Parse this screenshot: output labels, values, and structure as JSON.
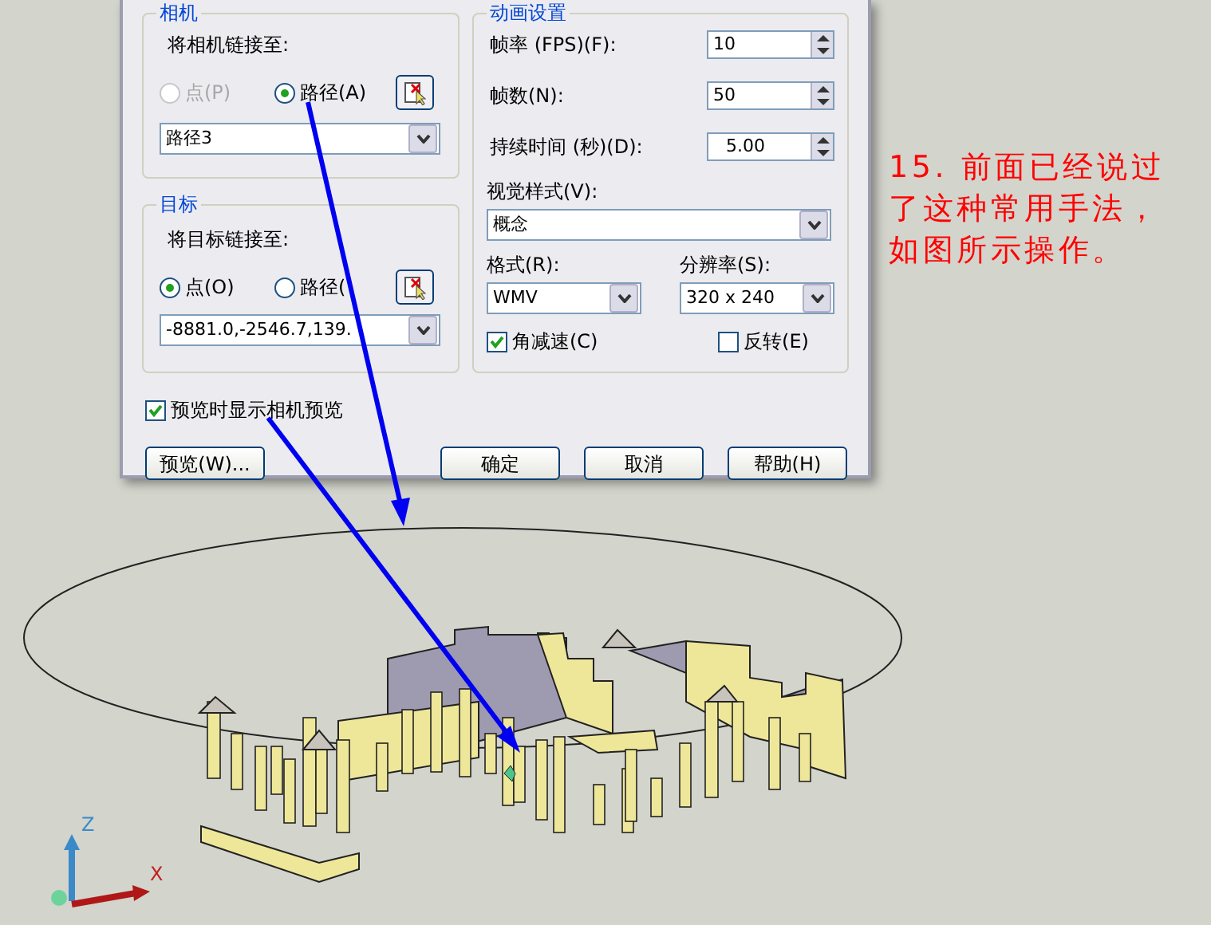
{
  "dialog": {
    "camera_group": {
      "title": "相机",
      "link_label": "将相机链接至:",
      "options": [
        {
          "label": "点(P)",
          "selected": false,
          "disabled": true
        },
        {
          "label": "路径(A)",
          "selected": true,
          "disabled": false
        }
      ],
      "path_value": "路径3"
    },
    "target_group": {
      "title": "目标",
      "link_label": "将目标链接至:",
      "options": [
        {
          "label": "点(O)",
          "selected": true,
          "disabled": false
        },
        {
          "label": "路径(",
          "selected": false,
          "disabled": false
        }
      ],
      "point_value": "-8881.0,-2546.7,139."
    },
    "preview_checkbox": {
      "label": "预览时显示相机预览",
      "checked": true
    },
    "animation_group": {
      "title": "动画设置",
      "spin_fields": [
        {
          "label": "帧率 (FPS)(F):",
          "value": "10"
        },
        {
          "label": "帧数(N):",
          "value": "50"
        },
        {
          "label": "持续时间 (秒)(D):",
          "value": "5.00"
        }
      ],
      "visual_style": {
        "label": "视觉样式(V):",
        "value": "概念"
      },
      "format": {
        "label": "格式(R):",
        "value": "WMV"
      },
      "resolution": {
        "label": "分辨率(S):",
        "value": "320 x 240"
      },
      "checkboxes": [
        {
          "label": "角减速(C)",
          "checked": true
        },
        {
          "label": "反转(E)",
          "checked": false
        }
      ]
    },
    "buttons": [
      {
        "label": "预览(W)..."
      },
      {
        "label": "确定"
      },
      {
        "label": "取消"
      },
      {
        "label": "帮助(H)"
      }
    ]
  },
  "annotation": "15. 前面已经说过了这种常用手法，如图所示操作。",
  "axis_labels": [
    "Z",
    "X"
  ]
}
